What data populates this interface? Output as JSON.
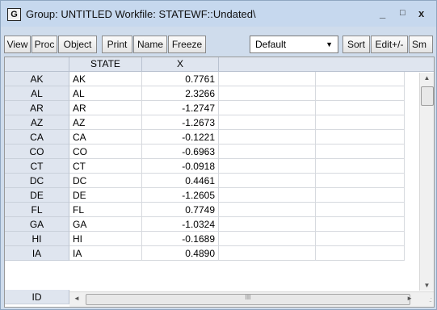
{
  "title": {
    "icon_letter": "G",
    "text": "Group: UNTITLED   Workfile: STATEWF::Undated\\",
    "min_glyph": "_",
    "max_glyph": "□",
    "close_glyph": "x"
  },
  "toolbar": {
    "view": "View",
    "proc": "Proc",
    "object": "Object",
    "print": "Print",
    "name": "Name",
    "freeze": "Freeze",
    "display_select": "Default",
    "sort": "Sort",
    "editpm": "Edit+/-",
    "smpl": "Sm"
  },
  "columns": [
    "STATE",
    "X"
  ],
  "rows": [
    {
      "obs": "AK",
      "state": "AK",
      "x": "0.7761"
    },
    {
      "obs": "AL",
      "state": "AL",
      "x": "2.3266"
    },
    {
      "obs": "AR",
      "state": "AR",
      "x": "-1.2747"
    },
    {
      "obs": "AZ",
      "state": "AZ",
      "x": "-1.2673"
    },
    {
      "obs": "CA",
      "state": "CA",
      "x": "-0.1221"
    },
    {
      "obs": "CO",
      "state": "CO",
      "x": "-0.6963"
    },
    {
      "obs": "CT",
      "state": "CT",
      "x": "-0.0918"
    },
    {
      "obs": "DC",
      "state": "DC",
      "x": "0.4461"
    },
    {
      "obs": "DE",
      "state": "DE",
      "x": "-1.2605"
    },
    {
      "obs": "FL",
      "state": "FL",
      "x": "0.7749"
    },
    {
      "obs": "GA",
      "state": "GA",
      "x": "-1.0324"
    },
    {
      "obs": "HI",
      "state": "HI",
      "x": "-0.1689"
    },
    {
      "obs": "IA",
      "state": "IA",
      "x": "0.4890"
    }
  ],
  "last_row_obs": "ID",
  "scrollbars": {
    "up_glyph": "▲",
    "down_glyph": "▼",
    "left_glyph": "◄",
    "right_glyph": "►",
    "grip_glyph": "III"
  },
  "colors": {
    "titlebar": "#c6d8ee",
    "header_bg": "#dfe5ef",
    "grid_line": "#d6d9de"
  }
}
